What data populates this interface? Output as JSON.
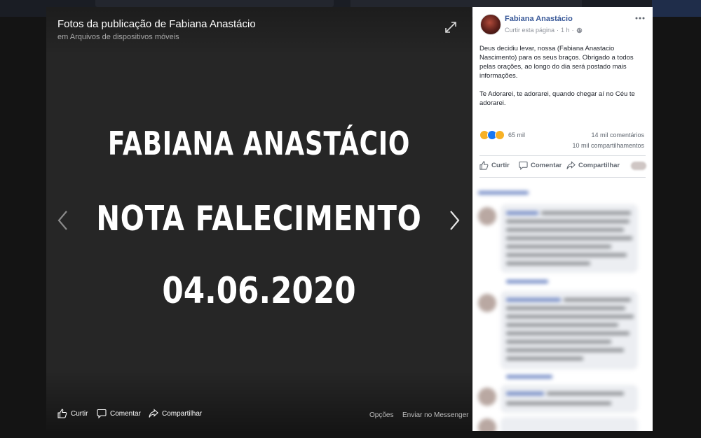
{
  "viewer": {
    "title": "Fotos da publicação de Fabiana Anastácio",
    "subtitle": "em Arquivos de dispositivos móveis",
    "photo_lines": [
      "FABIANA ANASTÁCIO",
      "NOTA FALECIMENTO",
      "04.06.2020"
    ],
    "actions": {
      "like": "Curtir",
      "comment": "Comentar",
      "share": "Compartilhar",
      "options": "Opções",
      "messenger": "Enviar no Messenger"
    }
  },
  "post": {
    "author": "Fabiana Anastácio",
    "follow": "Curtir esta página",
    "dot": "·",
    "time": "1 h",
    "paragraphs": [
      "Deus decidiu levar, nossa (Fabiana Anastacio Nascimento) para os seus braços. Obrigado a todos pelas orações, ao longo do dia será postado mais informações.",
      "Te Adorarei, te adorarei, quando chegar aí no Céu te adorarei."
    ],
    "reactions_count": "65 mil",
    "comments_count": "14 mil comentários",
    "shares_count": "10 mil compartilhamentos",
    "actions": {
      "like": "Curtir",
      "comment": "Comentar",
      "share": "Compartilhar"
    }
  },
  "colors": {
    "link_blue": "#385898",
    "like_blue": "#1877f2",
    "reaction_yellow": "#f7b125"
  }
}
